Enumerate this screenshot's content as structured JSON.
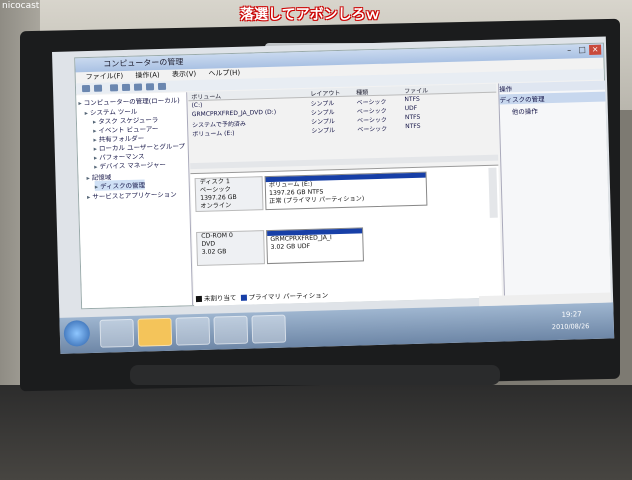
{
  "overlay": {
    "channel": "nicocast",
    "comment": "落選してアボンしろｗ"
  },
  "window": {
    "title": "コンピューターの管理",
    "menu": [
      "ファイル(F)",
      "操作(A)",
      "表示(V)",
      "ヘルプ(H)"
    ]
  },
  "tree": {
    "items": [
      "コンピューターの管理(ローカル)",
      "システム ツール",
      "タスク スケジューラ",
      "イベント ビューアー",
      "共有フォルダー",
      "ローカル ユーザーとグループ",
      "パフォーマンス",
      "デバイス マネージャー",
      "記憶域",
      "ディスクの管理",
      "サービスとアプリケーション"
    ]
  },
  "volumes": {
    "headers": [
      "ボリューム",
      "レイアウト",
      "種類",
      "ファイル"
    ],
    "rows": [
      {
        "name": "(C:)",
        "layout": "シンプル",
        "type": "ベーシック",
        "fs": "NTFS"
      },
      {
        "name": "GRMCPRXFRED_JA_DVD (D:)",
        "layout": "シンプル",
        "type": "ベーシック",
        "fs": "UDF"
      },
      {
        "name": "システムで予約済み",
        "layout": "シンプル",
        "type": "ベーシック",
        "fs": "NTFS"
      },
      {
        "name": "ボリューム (E:)",
        "layout": "シンプル",
        "type": "ベーシック",
        "fs": "NTFS"
      }
    ]
  },
  "disks": [
    {
      "label": "ディスク 1",
      "kind": "ベーシック",
      "size": "1397.26 GB",
      "status": "オンライン",
      "part_name": "ボリューム (E:)",
      "part_size": "1397.26 GB NTFS",
      "part_status": "正常 (プライマリ パーティション)"
    },
    {
      "label": "CD-ROM 0",
      "kind": "DVD",
      "size": "3.02 GB",
      "status": "",
      "part_name": "GRMCPRXFRED_JA_I",
      "part_size": "3.02 GB UDF",
      "part_status": ""
    }
  ],
  "legend": {
    "unallocated": "未割り当て",
    "primary": "プライマリ パーティション"
  },
  "actions": {
    "header": "操作",
    "section": "ディスクの管理",
    "more": "他の操作"
  },
  "clock": {
    "time": "19:27",
    "date": "2010/08/26"
  },
  "colors": {
    "partition_bar": "#173fa7",
    "comment_outline": "#cc0000"
  }
}
